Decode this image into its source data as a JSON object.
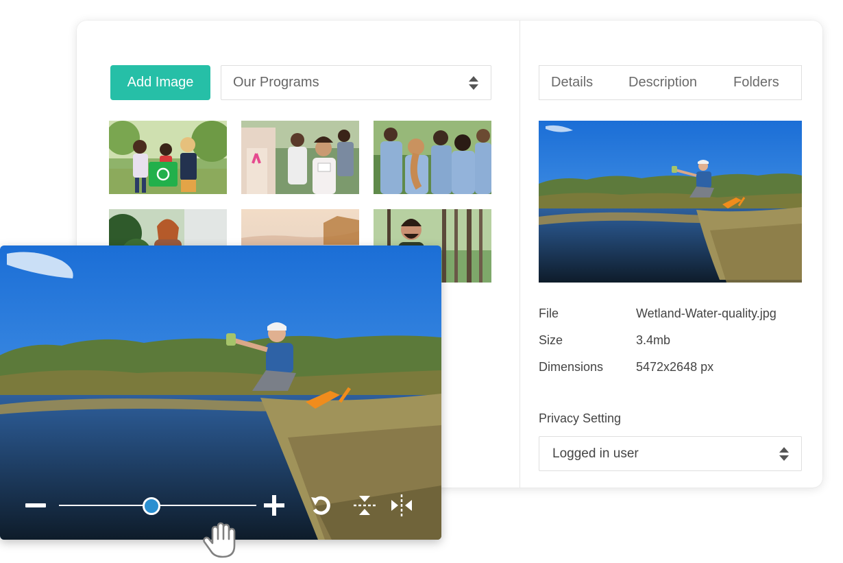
{
  "toolbar": {
    "add_image_label": "Add Image",
    "folder_select_value": "Our Programs"
  },
  "gallery": {
    "items": [
      {
        "name": "kids-recycling-photo"
      },
      {
        "name": "pink-ribbon-run-photo"
      },
      {
        "name": "volunteers-group-photo"
      },
      {
        "name": "woman-outdoors-photo"
      },
      {
        "name": "misty-lake-photo"
      },
      {
        "name": "smiling-man-forest-photo"
      }
    ]
  },
  "details_panel": {
    "tabs": [
      "Details",
      "Description",
      "Folders"
    ],
    "file_label": "File",
    "file_value": "Wetland-Water-quality.jpg",
    "size_label": "Size",
    "size_value": "3.4mb",
    "dimensions_label": "Dimensions",
    "dimensions_value": "5472x2648 px",
    "privacy_label": "Privacy Setting",
    "privacy_value": "Logged in user"
  },
  "editor": {
    "zoom_level": 0.47,
    "icons": [
      "minus-icon",
      "plus-icon",
      "rotate-icon",
      "flip-vertical-icon",
      "flip-horizontal-icon",
      "hand-cursor-icon"
    ]
  },
  "colors": {
    "accent": "#26bfa7",
    "slider_knob": "#2a8fd0"
  }
}
